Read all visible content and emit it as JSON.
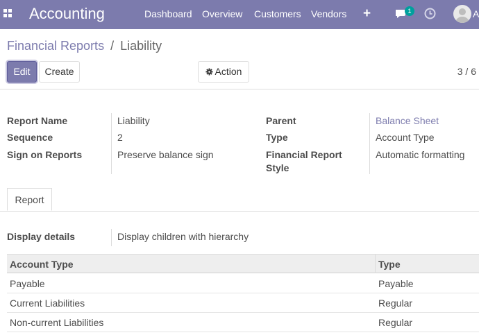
{
  "navbar": {
    "app_title": "Accounting",
    "menu": [
      "Dashboard",
      "Overview",
      "Customers",
      "Vendors"
    ],
    "chat_badge": "1",
    "user_initial": "A",
    "bg_color": "#7c7bad"
  },
  "breadcrumb": {
    "parent": "Financial Reports",
    "separator": "/",
    "current": "Liability"
  },
  "buttons": {
    "edit": "Edit",
    "create": "Create",
    "action": "Action"
  },
  "pager": "3 / 6",
  "form": {
    "report_name_label": "Report Name",
    "report_name_value": "Liability",
    "sequence_label": "Sequence",
    "sequence_value": "2",
    "sign_label": "Sign on Reports",
    "sign_value": "Preserve balance sign",
    "parent_label": "Parent",
    "parent_value": "Balance Sheet",
    "type_label": "Type",
    "type_value": "Account Type",
    "style_label_line1": "Financial Report",
    "style_label_line2": "Style",
    "style_value": "Automatic formatting"
  },
  "tabs": [
    "Report"
  ],
  "report_tab": {
    "display_details_label": "Display details",
    "display_details_value": "Display children with hierarchy",
    "table": {
      "headers": [
        "Account Type",
        "Type"
      ],
      "rows": [
        [
          "Payable",
          "Payable"
        ],
        [
          "Current Liabilities",
          "Regular"
        ],
        [
          "Non-current Liabilities",
          "Regular"
        ]
      ]
    }
  },
  "colors": {
    "brand": "#7c7bad",
    "badge": "#00a09d",
    "link": "#7c7bad"
  }
}
